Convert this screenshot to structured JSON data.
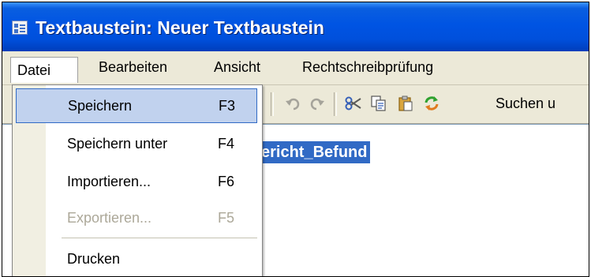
{
  "window": {
    "title": "Textbaustein: Neuer Textbaustein",
    "title_icon": "document-window-icon"
  },
  "menubar": {
    "items": [
      {
        "label": "Datei",
        "open": true
      },
      {
        "label": "Bearbeiten"
      },
      {
        "label": "Ansicht"
      },
      {
        "label": "Rechtschreibprüfung"
      }
    ]
  },
  "toolbar": {
    "icons": [
      "undo-icon",
      "redo-icon",
      "cut-icon",
      "copy-icon",
      "paste-icon",
      "replace-icon"
    ],
    "search_label": "Suchen u"
  },
  "editor": {
    "selected_text": "ericht_Befund"
  },
  "file_menu": {
    "items": [
      {
        "label": "Speichern",
        "shortcut": "F3",
        "state": "highlighted"
      },
      {
        "label": "Speichern unter",
        "shortcut": "F4"
      },
      {
        "label": "Importieren...",
        "shortcut": "F6"
      },
      {
        "label": "Exportieren...",
        "shortcut": "F5",
        "state": "disabled"
      },
      {
        "label": "Drucken",
        "shortcut": ""
      }
    ]
  },
  "colors": {
    "titlebar": "#0054e3",
    "selection": "#316ac5",
    "menu_highlight": "#c1d2ee"
  }
}
